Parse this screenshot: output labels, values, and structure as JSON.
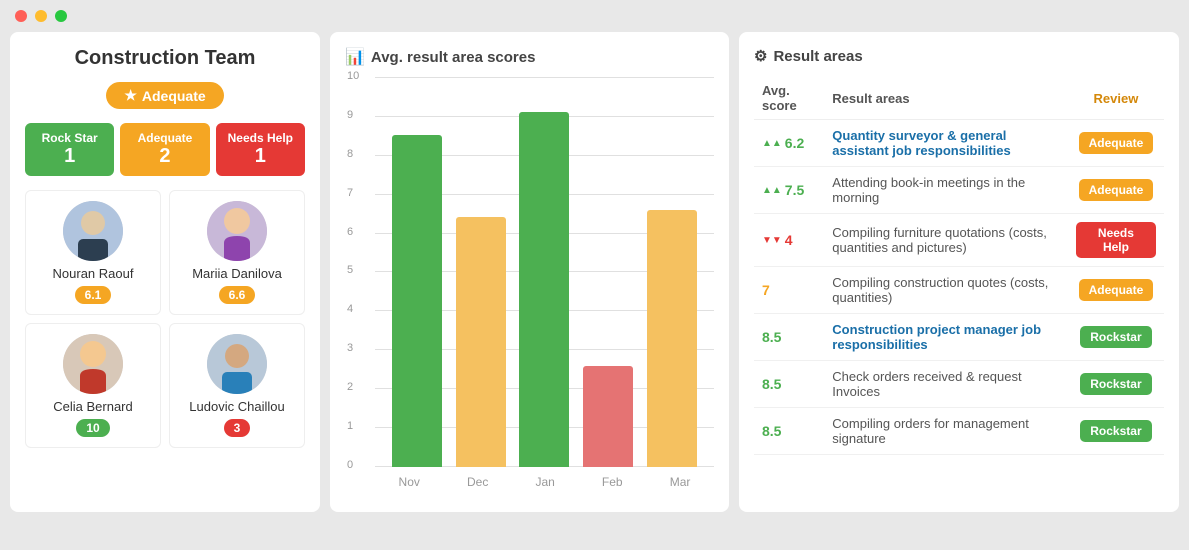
{
  "window": {
    "traffic_lights": [
      "red",
      "yellow",
      "green"
    ]
  },
  "left_panel": {
    "title": "Construction Team",
    "overall_badge": "Adequate",
    "stats": [
      {
        "label": "Rock Star",
        "value": "1",
        "color": "green"
      },
      {
        "label": "Adequate",
        "value": "2",
        "color": "orange"
      },
      {
        "label": "Needs Help",
        "value": "1",
        "color": "red"
      }
    ],
    "members": [
      {
        "name": "Nouran Raouf",
        "score": "6.1",
        "score_color": "orange"
      },
      {
        "name": "Mariia Danilova",
        "score": "6.6",
        "score_color": "orange"
      },
      {
        "name": "Celia Bernard",
        "score": "10",
        "score_color": "green"
      },
      {
        "name": "Ludovic Chaillou",
        "score": "3",
        "score_color": "red"
      }
    ]
  },
  "chart_panel": {
    "title": "Avg. result area scores",
    "y_labels": [
      "10",
      "9",
      "8",
      "7",
      "6",
      "5",
      "4",
      "3",
      "2",
      "1",
      "0"
    ],
    "bars": [
      {
        "month": "Nov",
        "value": 8.5,
        "color": "#4caf50",
        "height_pct": 85
      },
      {
        "month": "Dec",
        "value": 6.4,
        "color": "#f5c160",
        "height_pct": 64
      },
      {
        "month": "Jan",
        "value": 9.1,
        "color": "#4caf50",
        "height_pct": 91
      },
      {
        "month": "Feb",
        "value": 2.6,
        "color": "#e57373",
        "height_pct": 26
      },
      {
        "month": "Mar",
        "value": 6.6,
        "color": "#f5c160",
        "height_pct": 66
      }
    ]
  },
  "result_panel": {
    "title": "Result areas",
    "col_avg": "Avg. score",
    "col_areas": "Result areas",
    "col_review": "Review",
    "rows": [
      {
        "score": "6.2",
        "score_color": "#4caf50",
        "arrow": "up",
        "area": "Quantity surveyor & general assistant job responsibilities",
        "bold": true,
        "review": "Adequate",
        "review_type": "adequate"
      },
      {
        "score": "7.5",
        "score_color": "#4caf50",
        "arrow": "up",
        "area": "Attending book-in meetings in the morning",
        "bold": false,
        "review": "Adequate",
        "review_type": "adequate"
      },
      {
        "score": "4",
        "score_color": "#e53935",
        "arrow": "down",
        "area": "Compiling furniture quotations (costs, quantities and pictures)",
        "bold": false,
        "review": "Needs Help",
        "review_type": "needs-help"
      },
      {
        "score": "7",
        "score_color": "#f5a623",
        "arrow": "none",
        "area": "Compiling construction quotes (costs, quantities)",
        "bold": false,
        "review": "Adequate",
        "review_type": "adequate"
      },
      {
        "score": "8.5",
        "score_color": "#4caf50",
        "arrow": "none",
        "area": "Construction project manager job responsibilities",
        "bold": true,
        "review": "Rockstar",
        "review_type": "rockstar"
      },
      {
        "score": "8.5",
        "score_color": "#4caf50",
        "arrow": "none",
        "area": "Check orders received & request Invoices",
        "bold": false,
        "review": "Rockstar",
        "review_type": "rockstar"
      },
      {
        "score": "8.5",
        "score_color": "#4caf50",
        "arrow": "none",
        "area": "Compiling orders for management signature",
        "bold": false,
        "review": "Rockstar",
        "review_type": "rockstar"
      }
    ]
  }
}
